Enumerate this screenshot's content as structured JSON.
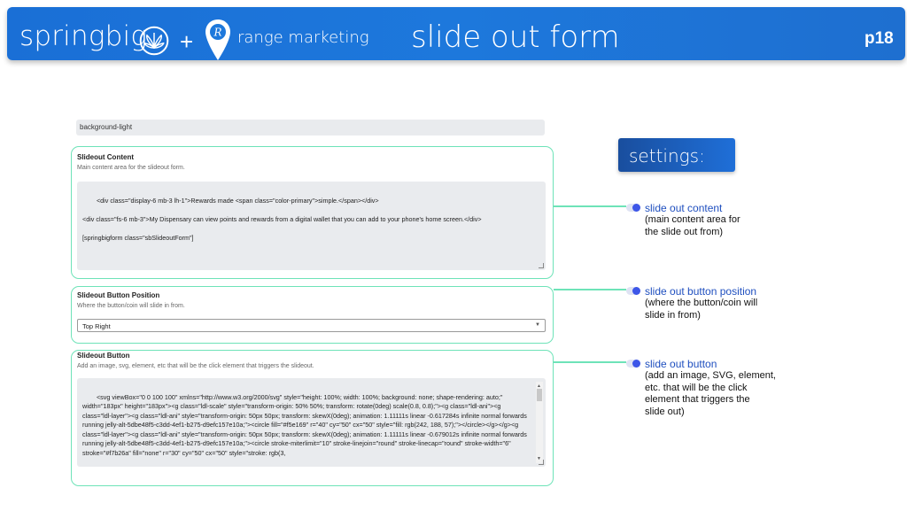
{
  "header": {
    "brand_springbig": "springbig",
    "plus": "+",
    "brand_range": "range marketing",
    "title": "slide out form",
    "page": "p18",
    "colors": {
      "banner": "#1d78dc",
      "text": "#ffffff"
    },
    "icons": [
      "cannabis-leaf-icon",
      "location-pin-icon"
    ]
  },
  "form": {
    "background_value": "background-light",
    "content": {
      "label": "Slideout Content",
      "description": "Main content area for the slideout form.",
      "value": "<div class=\"display-6 mb-3 lh-1\">Rewards made <span class=\"color-primary\">simple.</span></div>\n\n<div class=\"fs-6 mb-3\">My Dispensary can view points and rewards from a digital wallet that you can add to your phone's home screen.</div>\n\n[springbigform class=\"sbSlideoutForm\"]"
    },
    "position": {
      "label": "Slideout Button Position",
      "description": "Where the button/coin will slide in from.",
      "selected": "Top Right"
    },
    "button": {
      "label": "Slideout Button",
      "description": "Add an image, svg, element, etc that will be the click element that triggers the slideout.",
      "value": "<svg viewBox=\"0 0 100 100\" xmlns=\"http://www.w3.org/2000/svg\" style=\"height: 100%; width: 100%; background: none; shape-rendering: auto;\" width=\"183px\" height=\"183px\"><g class=\"ldl-scale\" style=\"transform-origin: 50% 50%; transform: rotate(0deg) scale(0.8, 0.8);\"><g class=\"ldl-ani\"><g class=\"ldl-layer\"><g class=\"ldl-ani\" style=\"transform-origin: 50px 50px; transform: skewX(0deg); animation: 1.11111s linear -0.617284s infinite normal forwards running jelly-alt-5dbe48f5-c3dd-4ef1-b275-d9efc157e10a;\"><circle fill=\"#f5e169\" r=\"40\" cy=\"50\" cx=\"50\" style=\"fill: rgb(242, 188, 57);\"></circle></g></g><g class=\"ldl-layer\"><g class=\"ldl-ani\" style=\"transform-origin: 50px 50px; transform: skewX(0deg); animation: 1.11111s linear -0.679012s infinite normal forwards running jelly-alt-5dbe48f5-c3dd-4ef1-b275-d9efc157e10a;\"><circle stroke-miterlimit=\"10\" stroke-linejoin=\"round\" stroke-linecap=\"round\" stroke-width=\"6\" stroke=\"#f7b26a\" fill=\"none\" r=\"30\" cy=\"50\" cx=\"50\" style=\"stroke: rgb(3,"
    },
    "accent_color": "#6ee3b8"
  },
  "settings": {
    "label": "settings:",
    "notes": [
      {
        "title": "slide out content",
        "desc": "(main content area for\nthe slide out from)"
      },
      {
        "title": "slide out button position",
        "desc": "(where the button/coin will\nslide in from)"
      },
      {
        "title": "slide out button",
        "desc": "(add an image, SVG, element,\netc. that will be the click\nelement that triggers the\nslide out)"
      }
    ],
    "colors": {
      "badge": "#1f6fd8",
      "note_title": "#1f4fbf",
      "toggle": "#3d56e8"
    }
  }
}
